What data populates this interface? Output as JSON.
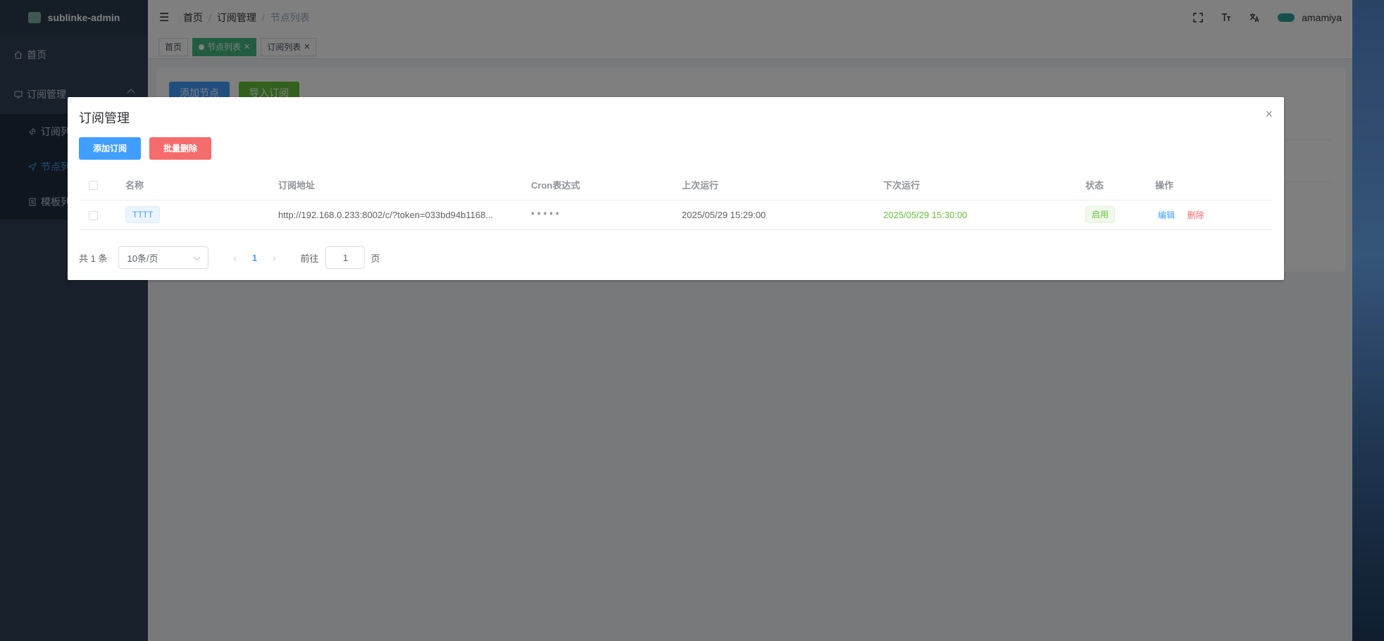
{
  "app": {
    "title": "sublinke-admin"
  },
  "sidebar": {
    "items": [
      {
        "label": "首页"
      },
      {
        "label": "订阅管理"
      },
      {
        "label": "订阅列"
      },
      {
        "label": "节点列"
      },
      {
        "label": "模板列"
      }
    ]
  },
  "navbar": {
    "breadcrumb": [
      "首页",
      "/",
      "订阅管理",
      "/",
      "节点列表"
    ],
    "icons": [
      "fullscreen-icon",
      "font-size-icon",
      "translate-icon",
      "settings-icon"
    ],
    "username": "amamiya"
  },
  "tags": [
    {
      "label": "首页"
    },
    {
      "label": "节点列表"
    },
    {
      "label": "订阅列表"
    }
  ],
  "background": {
    "add_node": "添加节点",
    "import_sub": "导入订阅"
  },
  "dialog": {
    "title": "订阅管理",
    "close": "×",
    "add_button": "添加订阅",
    "batch_delete_button": "批量删除",
    "columns": [
      "名称",
      "订阅地址",
      "Cron表达式",
      "上次运行",
      "下次运行",
      "状态",
      "操作"
    ],
    "rows": [
      {
        "name": "TTTT",
        "url": "http://192.168.0.233:8002/c/?token=033bd94b1168...",
        "cron": "* * * * *",
        "last_run": "2025/05/29 15:29:00",
        "next_run": "2025/05/29 15:30:00",
        "status": "启用",
        "edit": "编辑",
        "delete": "删除"
      }
    ],
    "pagination": {
      "total": "共 1 条",
      "page_size": "10条/页",
      "prev": "‹",
      "current": "1",
      "next": "›",
      "goto_label": "前往",
      "goto_value": "1",
      "goto_unit": "页"
    }
  },
  "colors": {
    "primary": "#409eff",
    "danger": "#f56c6c",
    "success": "#67c23a",
    "sidebar": "#304156"
  }
}
